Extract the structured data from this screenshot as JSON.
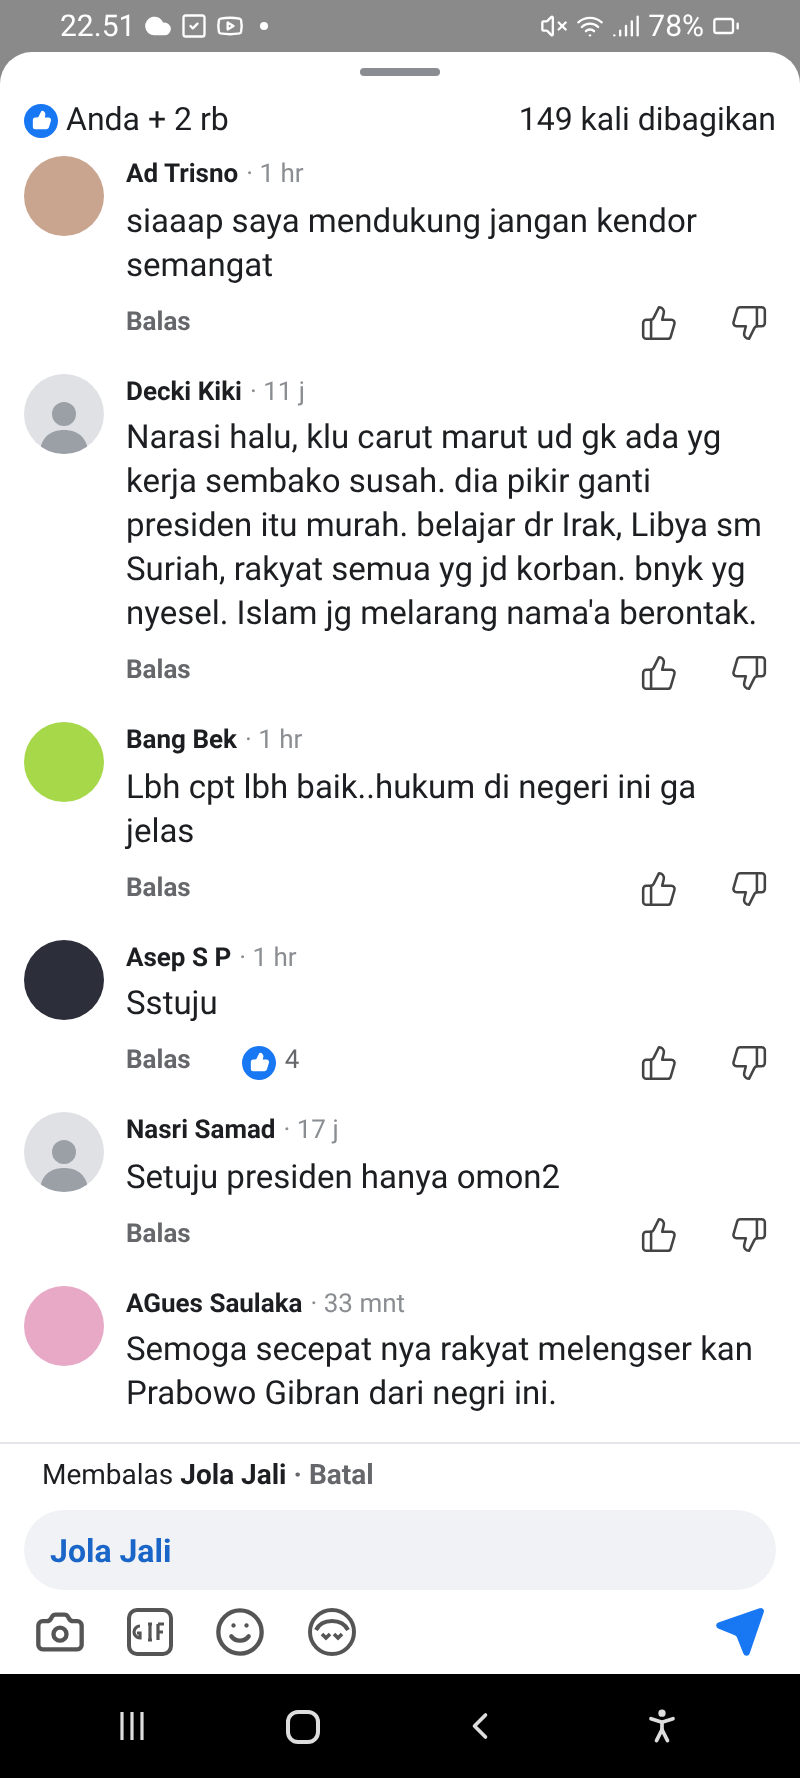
{
  "status_bar": {
    "time": "22.51",
    "battery": "78%"
  },
  "header": {
    "reactions": "Anda + 2 rb",
    "shares": "149 kali dibagikan"
  },
  "comments": [
    {
      "author": "Ad Trisno",
      "time": "· 1 hr",
      "text": "siaaap saya mendukung jangan kendor semangat",
      "kind": "photo",
      "color": "#c9a48f",
      "reply": "Balas"
    },
    {
      "author": "Decki Kiki",
      "time": "· 11 j",
      "text": "Narasi halu, klu carut marut ud gk ada yg kerja sembako susah. dia pikir ganti presiden itu murah. belajar dr Irak, Libya sm Suriah, rakyat semua yg jd korban. bnyk yg nyesel. Islam jg melarang nama'a berontak.",
      "kind": "default",
      "reply": "Balas"
    },
    {
      "author": "Bang Bek",
      "time": "· 1 hr",
      "text": "Lbh cpt lbh baik..hukum di negeri ini ga jelas",
      "kind": "photo",
      "color": "#a6d84a",
      "reply": "Balas"
    },
    {
      "author": "Asep S P",
      "time": "· 1 hr",
      "text": "Sstuju",
      "kind": "photo",
      "color": "#2c2f3a",
      "reply": "Balas",
      "likes": "4"
    },
    {
      "author": "Nasri Samad",
      "time": "· 17 j",
      "text": "Setuju presiden hanya omon2",
      "kind": "default",
      "reply": "Balas"
    },
    {
      "author": "AGues Saulaka",
      "time": "· 33 mnt",
      "text": "Semoga secepat nya rakyat melengser kan Prabowo Gibran dari negri ini.",
      "kind": "photo",
      "color": "#e7a9c6"
    }
  ],
  "compose": {
    "replying_to": "Membalas",
    "name": "Jola Jali",
    "cancel": "· Batal",
    "value": "Jola Jali"
  }
}
